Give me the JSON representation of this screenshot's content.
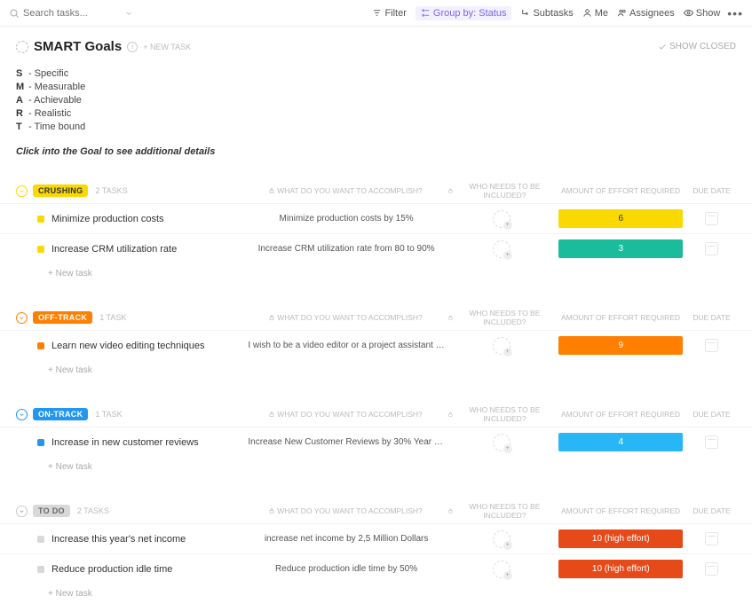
{
  "toolbar": {
    "search_placeholder": "Search tasks...",
    "filter": "Filter",
    "group_by": "Group by: Status",
    "subtasks": "Subtasks",
    "me": "Me",
    "assignees": "Assignees",
    "show": "Show"
  },
  "header": {
    "title": "SMART Goals",
    "new_task": "+ NEW TASK",
    "show_closed": "SHOW CLOSED"
  },
  "smart": [
    {
      "letter": "S",
      "text": "- Specific"
    },
    {
      "letter": "M",
      "text": "- Measurable"
    },
    {
      "letter": "A",
      "text": "- Achievable"
    },
    {
      "letter": "R",
      "text": "- Realistic"
    },
    {
      "letter": "T",
      "text": "- Time bound"
    }
  ],
  "click_hint": "Click into the Goal to see additional details",
  "columns": {
    "accomplish": "WHAT DO YOU WANT TO ACCOMPLISH?",
    "who": "WHO NEEDS TO BE INCLUDED?",
    "effort": "AMOUNT OF EFFORT REQUIRED",
    "due": "DUE DATE"
  },
  "new_task_label": "+ New task",
  "groups": [
    {
      "status": "CRUSHING",
      "badge_class": "badge-crushing",
      "sq_class": "sq-crushing",
      "collapse_class": "colored-yellow",
      "count": "2 TASKS",
      "tasks": [
        {
          "name": "Minimize production costs",
          "accomplish": "Minimize production costs by 15%",
          "effort_label": "6",
          "effort_class": "ef-6"
        },
        {
          "name": "Increase CRM utilization rate",
          "accomplish": "Increase CRM utilization rate from 80 to 90%",
          "effort_label": "3",
          "effort_class": "ef-3"
        }
      ]
    },
    {
      "status": "OFF-TRACK",
      "badge_class": "badge-offtrack",
      "sq_class": "sq-offtrack",
      "collapse_class": "colored-orange",
      "count": "1 TASK",
      "tasks": [
        {
          "name": "Learn new video editing techniques",
          "accomplish": "I wish to be a video editor or a project assistant mainly ...",
          "effort_label": "9",
          "effort_class": "ef-9"
        }
      ]
    },
    {
      "status": "ON-TRACK",
      "badge_class": "badge-ontrack",
      "sq_class": "sq-ontrack",
      "collapse_class": "colored-blue",
      "count": "1 TASK",
      "tasks": [
        {
          "name": "Increase in new customer reviews",
          "accomplish": "Increase New Customer Reviews by 30% Year Over Year...",
          "effort_label": "4",
          "effort_class": "ef-4"
        }
      ]
    },
    {
      "status": "TO DO",
      "badge_class": "badge-todo",
      "sq_class": "sq-todo",
      "collapse_class": "",
      "count": "2 TASKS",
      "tasks": [
        {
          "name": "Increase this year's net income",
          "accomplish": "increase net income by 2,5 Million Dollars",
          "effort_label": "10 (high effort)",
          "effort_class": "ef-10"
        },
        {
          "name": "Reduce production idle time",
          "accomplish": "Reduce production idle time by 50%",
          "effort_label": "10 (high effort)",
          "effort_class": "ef-10"
        }
      ]
    }
  ]
}
